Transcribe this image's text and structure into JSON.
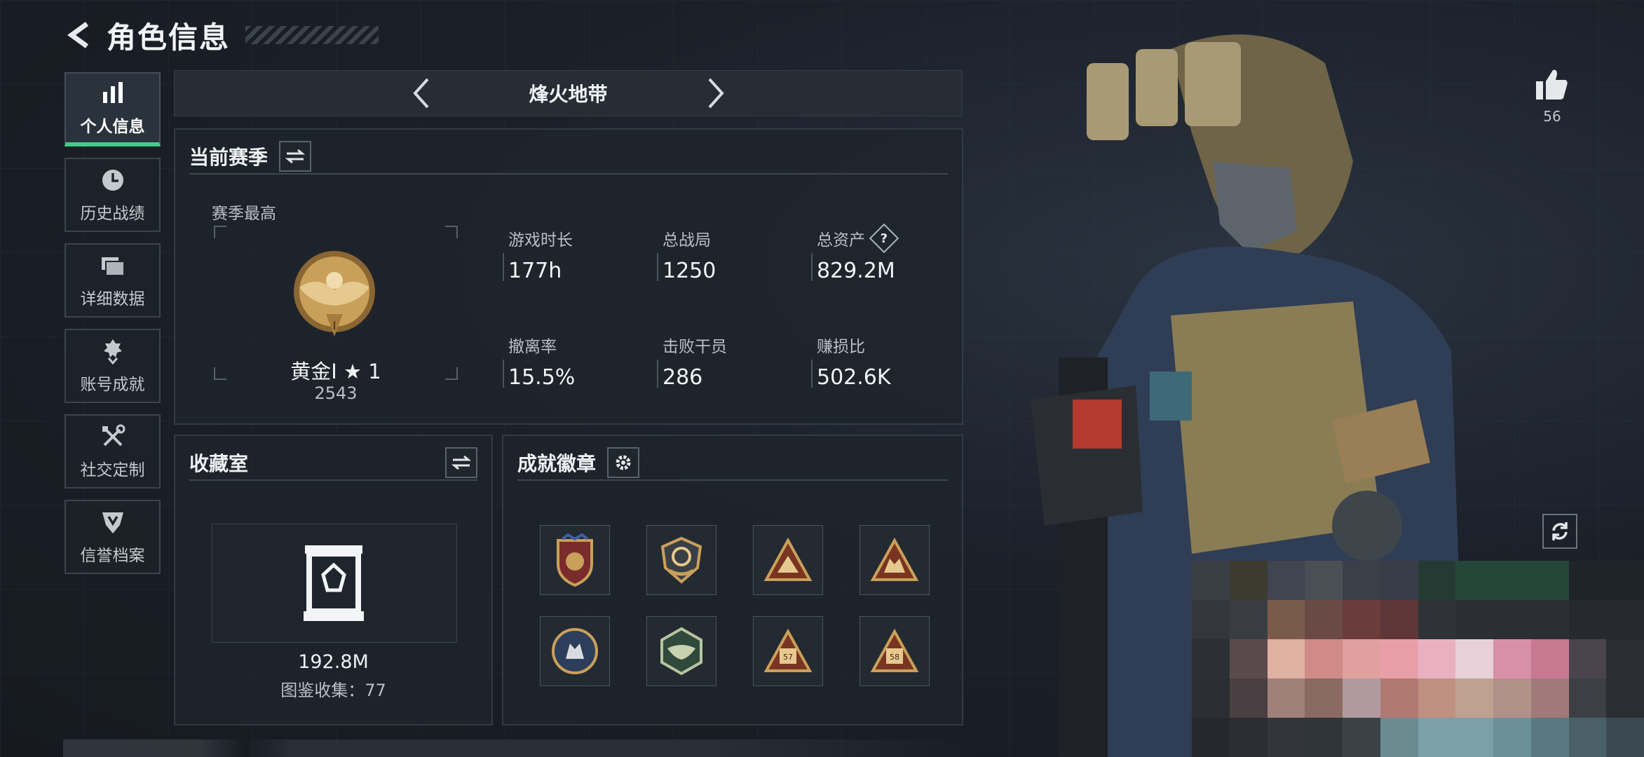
{
  "header": {
    "title": "角色信息"
  },
  "nav": {
    "items": [
      {
        "label": "个人信息",
        "icon": "bar-chart-icon",
        "active": true
      },
      {
        "label": "历史战绩",
        "icon": "clock-icon"
      },
      {
        "label": "详细数据",
        "icon": "folder-icon"
      },
      {
        "label": "账号成就",
        "icon": "medal-icon"
      },
      {
        "label": "社交定制",
        "icon": "tools-icon"
      },
      {
        "label": "信誉档案",
        "icon": "shield-icon"
      }
    ]
  },
  "map": {
    "name": "烽火地带"
  },
  "season": {
    "title": "当前赛季",
    "best_label": "赛季最高",
    "rank_name": "黄金Ⅰ ★ 1",
    "rank_score": "2543",
    "stats": [
      {
        "key": "游戏时长",
        "value": "177h"
      },
      {
        "key": "总战局",
        "value": "1250"
      },
      {
        "key": "总资产",
        "value": "829.2M",
        "help": "?"
      },
      {
        "key": "撤离率",
        "value": "15.5%"
      },
      {
        "key": "击败干员",
        "value": "286"
      },
      {
        "key": "赚损比",
        "value": "502.6K"
      }
    ]
  },
  "collection": {
    "title": "收藏室",
    "value": "192.8M",
    "count": "图鉴收集：77"
  },
  "achievements": {
    "title": "成就徽章",
    "badges": [
      "shield-crest-icon",
      "anchor-crest-icon",
      "mountain-triangle-icon",
      "wolf-triangle-icon",
      "wolf-round-icon",
      "eagle-hex-icon",
      "57-triangle-icon",
      "58-triangle-icon"
    ]
  },
  "like": {
    "count": "56"
  },
  "colors": {
    "accent": "#39d18a",
    "bg": "#1a1f26",
    "panel": "#1e242b",
    "gold": "#c9a05a"
  }
}
